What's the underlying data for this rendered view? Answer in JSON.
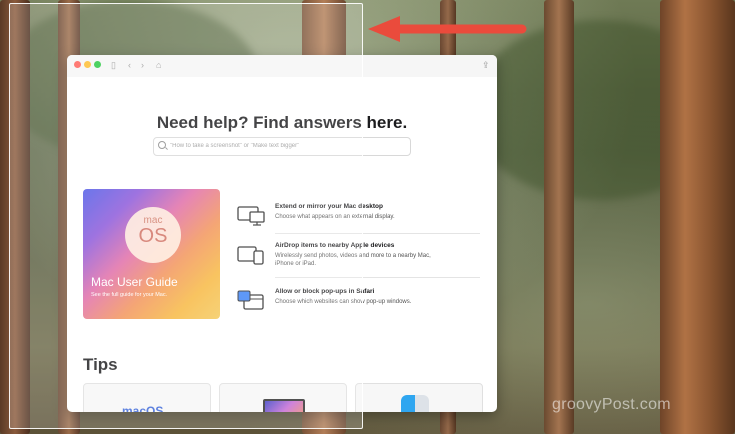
{
  "help": {
    "heading": "Need help? Find answers here.",
    "search_placeholder": "\"How to take a screenshot\" or \"Make text bigger\""
  },
  "guide": {
    "badge_top": "mac",
    "badge_bottom": "OS",
    "title": "Mac User Guide",
    "subtitle": "See the full guide for your Mac."
  },
  "topics": [
    {
      "title": "Extend or mirror your Mac desktop",
      "desc": "Choose what appears on an external display.",
      "icon": "display-icon"
    },
    {
      "title": "AirDrop items to nearby Apple devices",
      "desc": "Wirelessly send photos, videos and more to a nearby Mac, iPhone or iPad.",
      "icon": "devices-icon"
    },
    {
      "title": "Allow or block pop-ups in Safari",
      "desc": "Choose which websites can show pop-up windows.",
      "icon": "popup-window-icon"
    }
  ],
  "tips": {
    "heading": "Tips",
    "card1_text": "macOS"
  },
  "colors": {
    "close": "#ff5f57",
    "minimize": "#febc2e",
    "zoom": "#28c840",
    "arrow": "#ea4b3c"
  },
  "watermark": "groovyPost.com"
}
